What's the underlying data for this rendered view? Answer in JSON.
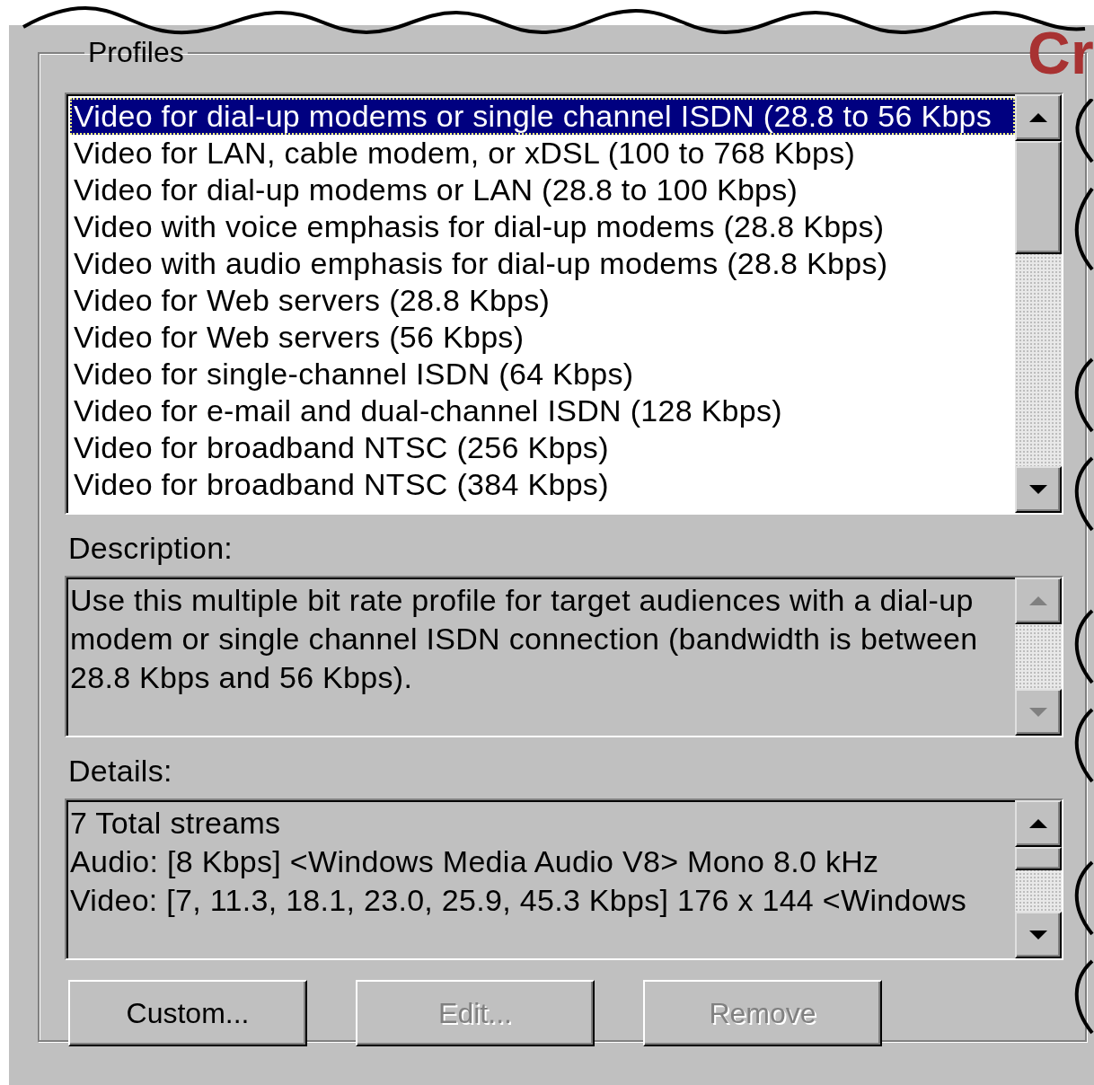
{
  "corner_heading": "Cr",
  "profiles": {
    "title": "Profiles",
    "items": [
      {
        "label": "Video for dial-up modems or single channel ISDN (28.8 to 56 Kbps",
        "selected": true
      },
      {
        "label": "Video for LAN, cable modem, or xDSL (100 to 768 Kbps)",
        "selected": false
      },
      {
        "label": "Video for dial-up modems or LAN (28.8 to 100 Kbps)",
        "selected": false
      },
      {
        "label": "Video with voice emphasis for dial-up modems (28.8 Kbps)",
        "selected": false
      },
      {
        "label": "Video with audio emphasis for dial-up modems (28.8 Kbps)",
        "selected": false
      },
      {
        "label": "Video for Web servers (28.8 Kbps)",
        "selected": false
      },
      {
        "label": "Video for Web servers (56 Kbps)",
        "selected": false
      },
      {
        "label": "Video for single-channel ISDN (64 Kbps)",
        "selected": false
      },
      {
        "label": "Video for e-mail and dual-channel ISDN (128 Kbps)",
        "selected": false
      },
      {
        "label": "Video for broadband NTSC (256 Kbps)",
        "selected": false
      },
      {
        "label": "Video for broadband NTSC (384 Kbps)",
        "selected": false
      }
    ]
  },
  "description": {
    "label": "Description:",
    "text": "Use this multiple bit rate profile for target audiences with a dial-up modem or single channel ISDN connection (bandwidth is between 28.8 Kbps and 56 Kbps).",
    "scroll_disabled": true
  },
  "details": {
    "label": "Details:",
    "lines": [
      "7 Total streams",
      "Audio: [8 Kbps] <Windows Media Audio V8> Mono 8.0 kHz",
      "Video: [7, 11.3, 18.1, 23.0, 25.9, 45.3 Kbps] 176 x 144 <Windows"
    ],
    "scroll_disabled": false
  },
  "buttons": [
    {
      "label": "Custom...",
      "disabled": false
    },
    {
      "label": "Edit...",
      "disabled": true
    },
    {
      "label": "Remove",
      "disabled": true
    }
  ]
}
